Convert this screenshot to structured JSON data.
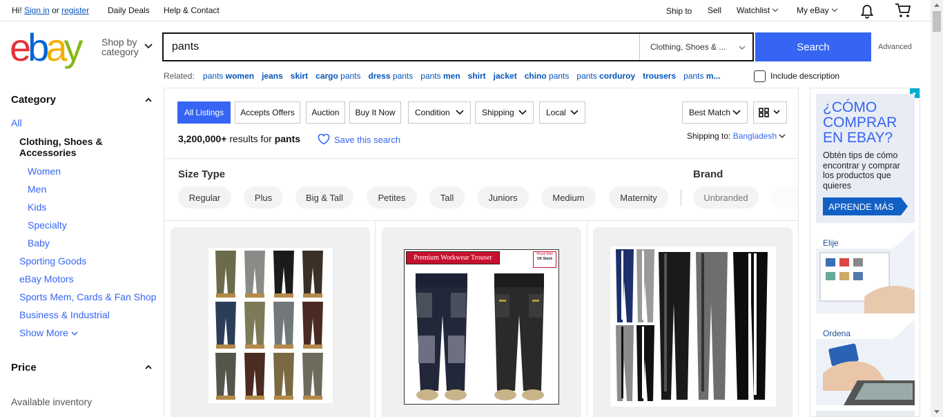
{
  "topbar": {
    "greeting": "Hi!",
    "sign_in": "Sign in",
    "or": "or",
    "register": "register",
    "daily_deals": "Daily Deals",
    "help_contact": "Help & Contact",
    "ship_to": "Ship to",
    "sell": "Sell",
    "watchlist": "Watchlist",
    "my_ebay": "My eBay"
  },
  "header": {
    "logo_letters": [
      "e",
      "b",
      "a",
      "y"
    ],
    "logo_colors": [
      "#e53238",
      "#0064d2",
      "#f5af02",
      "#86b817"
    ],
    "shop_by_line1": "Shop by",
    "shop_by_line2": "category",
    "search_value": "pants",
    "category_select": "Clothing, Shoes & ...",
    "search_button": "Search",
    "advanced": "Advanced",
    "accent": "#3665f3"
  },
  "related": {
    "label": "Related:",
    "items": [
      {
        "pre": "pants ",
        "bold": "women"
      },
      {
        "pre": "",
        "bold": "jeans"
      },
      {
        "pre": "",
        "bold": "skirt"
      },
      {
        "pre": "",
        "bold": "cargo",
        "post": " pants"
      },
      {
        "pre": "",
        "bold": "dress",
        "post": " pants"
      },
      {
        "pre": "pants ",
        "bold": "men"
      },
      {
        "pre": "",
        "bold": "shirt"
      },
      {
        "pre": "",
        "bold": "jacket"
      },
      {
        "pre": "",
        "bold": "chino",
        "post": " pants"
      },
      {
        "pre": "pants ",
        "bold": "corduroy"
      },
      {
        "pre": "",
        "bold": "trousers"
      },
      {
        "pre": "pants ",
        "bold": "m..."
      }
    ],
    "include_description": "Include description"
  },
  "sidebar": {
    "category_title": "Category",
    "all": "All",
    "selected": "Clothing, Shoes & Accessories",
    "subcats": [
      "Women",
      "Men",
      "Kids",
      "Specialty",
      "Baby"
    ],
    "cats": [
      "Sporting Goods",
      "eBay Motors",
      "Sports Mem, Cards & Fan Shop",
      "Business & Industrial"
    ],
    "show_more": "Show More",
    "price_title": "Price",
    "available_inventory": "Available inventory"
  },
  "filters": {
    "tabs": [
      "All Listings",
      "Accepts Offers",
      "Auction",
      "Buy It Now"
    ],
    "dropdowns": [
      "Condition",
      "Shipping",
      "Local"
    ],
    "sort": "Best Match",
    "results_count": "3,200,000+",
    "results_for": " results for ",
    "query": "pants",
    "save_search": "Save this search",
    "shipping_to_label": "Shipping to:",
    "shipping_to_value": "Bangladesh"
  },
  "size_type": {
    "title": "Size Type",
    "options": [
      "Regular",
      "Plus",
      "Big & Tall",
      "Petites",
      "Tall",
      "Juniors",
      "Medium",
      "Maternity"
    ]
  },
  "brand": {
    "title": "Brand",
    "options": [
      "Unbranded"
    ]
  },
  "listings": [
    {
      "badge": ""
    },
    {
      "badge": "Premium Workwear Trouser",
      "stamp_line1": "Royal Mail",
      "stamp_line2": "UK Stock"
    },
    {
      "badge": ""
    }
  ],
  "ads": {
    "headline": "¿CÓMO COMPRAR EN EBAY?",
    "body": "Obtén tips de cómo encontrar y comprar los productos que quieres",
    "cta": "APRENDE MÁS",
    "step1": "Elije",
    "step2": "Ordena"
  }
}
